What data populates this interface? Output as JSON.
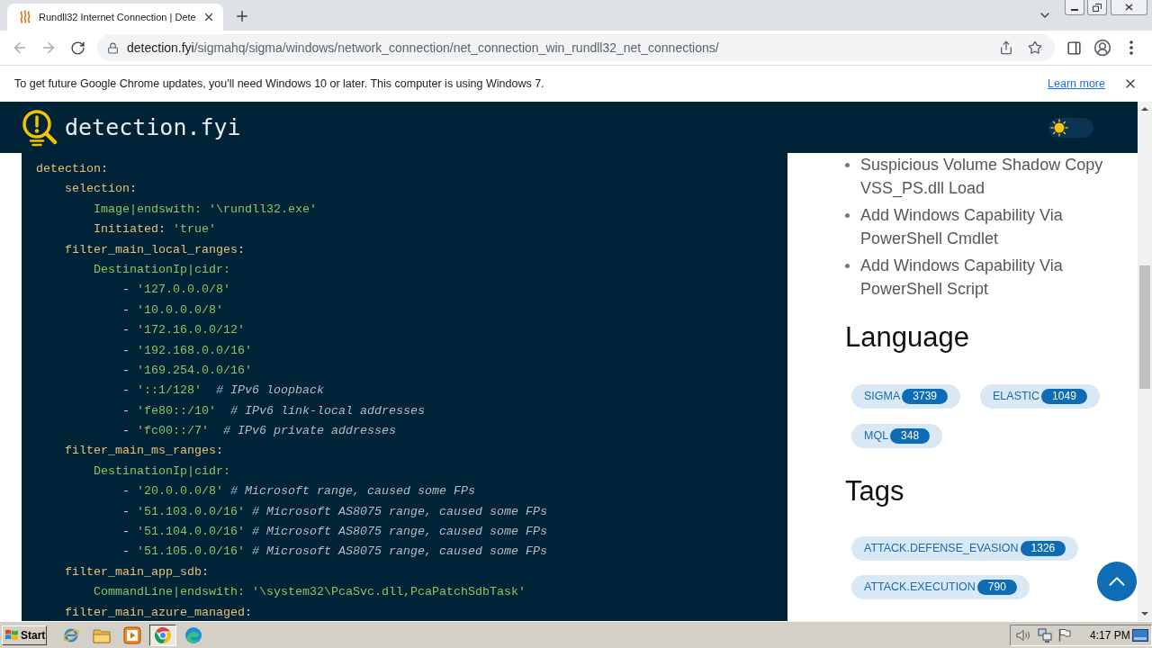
{
  "browser": {
    "tabs": [
      {
        "title": "Rundll32 Internet Connection | Dete",
        "selected": true
      }
    ],
    "address": {
      "host": "detection.fyi",
      "path": "/sigmahq/sigma/windows/network_connection/net_connection_win_rundll32_net_connections/"
    },
    "infobar": {
      "message": "To get future Google Chrome updates, you'll need Windows 10 or later. This computer is using Windows 7.",
      "link": "Learn more"
    }
  },
  "site_header": {
    "logo_text": "detection.fyi",
    "theme_toggle": {
      "on": false
    }
  },
  "code": [
    {
      "parts": [
        {
          "kind": "key",
          "text": "detection"
        },
        {
          "kind": "punct",
          "text": ":"
        }
      ],
      "children": [
        {
          "parts": [
            {
              "kind": "key",
              "text": "selection"
            },
            {
              "kind": "punct",
              "text": ":"
            }
          ],
          "children": [
            {
              "parts": [
                {
                  "kind": "field",
                  "text": "Image|endswith:"
                },
                {
                  "kind": "string",
                  "text": " '\\rundll32.exe'"
                }
              ]
            },
            {
              "parts": [
                {
                  "kind": "key",
                  "text": "Initiated"
                },
                {
                  "kind": "punct",
                  "text": ": "
                },
                {
                  "kind": "string",
                  "text": "'true'"
                }
              ]
            }
          ]
        },
        {
          "parts": [
            {
              "kind": "key",
              "text": "filter_main_local_ranges"
            },
            {
              "kind": "punct",
              "text": ":"
            }
          ],
          "children": [
            {
              "parts": [
                {
                  "kind": "field",
                  "text": "DestinationIp|cidr:"
                }
              ],
              "children": [
                {
                  "parts": [
                    {
                      "kind": "punct",
                      "text": "- "
                    },
                    {
                      "kind": "string",
                      "text": "'127.0.0.0/8'"
                    }
                  ]
                },
                {
                  "parts": [
                    {
                      "kind": "punct",
                      "text": "- "
                    },
                    {
                      "kind": "string",
                      "text": "'10.0.0.0/8'"
                    }
                  ]
                },
                {
                  "parts": [
                    {
                      "kind": "punct",
                      "text": "- "
                    },
                    {
                      "kind": "string",
                      "text": "'172.16.0.0/12'"
                    }
                  ]
                },
                {
                  "parts": [
                    {
                      "kind": "punct",
                      "text": "- "
                    },
                    {
                      "kind": "string",
                      "text": "'192.168.0.0/16'"
                    }
                  ]
                },
                {
                  "parts": [
                    {
                      "kind": "punct",
                      "text": "- "
                    },
                    {
                      "kind": "string",
                      "text": "'169.254.0.0/16'"
                    }
                  ]
                },
                {
                  "parts": [
                    {
                      "kind": "punct",
                      "text": "- "
                    },
                    {
                      "kind": "string",
                      "text": "'::1/128'"
                    },
                    {
                      "kind": "comment",
                      "text": "  # IPv6 loopback"
                    }
                  ]
                },
                {
                  "parts": [
                    {
                      "kind": "punct",
                      "text": "- "
                    },
                    {
                      "kind": "string",
                      "text": "'fe80::/10'"
                    },
                    {
                      "kind": "comment",
                      "text": "  # IPv6 link-local addresses"
                    }
                  ]
                },
                {
                  "parts": [
                    {
                      "kind": "punct",
                      "text": "- "
                    },
                    {
                      "kind": "string",
                      "text": "'fc00::/7'"
                    },
                    {
                      "kind": "comment",
                      "text": "  # IPv6 private addresses"
                    }
                  ]
                }
              ]
            }
          ]
        },
        {
          "parts": [
            {
              "kind": "key",
              "text": "filter_main_ms_ranges"
            },
            {
              "kind": "punct",
              "text": ":"
            }
          ],
          "children": [
            {
              "parts": [
                {
                  "kind": "field",
                  "text": "DestinationIp|cidr:"
                }
              ],
              "children": [
                {
                  "parts": [
                    {
                      "kind": "punct",
                      "text": "- "
                    },
                    {
                      "kind": "string",
                      "text": "'20.0.0.0/8'"
                    },
                    {
                      "kind": "comment",
                      "text": " # Microsoft range, caused some FPs"
                    }
                  ]
                },
                {
                  "parts": [
                    {
                      "kind": "punct",
                      "text": "- "
                    },
                    {
                      "kind": "string",
                      "text": "'51.103.0.0/16'"
                    },
                    {
                      "kind": "comment",
                      "text": " # Microsoft AS8075 range, caused some FPs"
                    }
                  ]
                },
                {
                  "parts": [
                    {
                      "kind": "punct",
                      "text": "- "
                    },
                    {
                      "kind": "string",
                      "text": "'51.104.0.0/16'"
                    },
                    {
                      "kind": "comment",
                      "text": " # Microsoft AS8075 range, caused some FPs"
                    }
                  ]
                },
                {
                  "parts": [
                    {
                      "kind": "punct",
                      "text": "- "
                    },
                    {
                      "kind": "string",
                      "text": "'51.105.0.0/16'"
                    },
                    {
                      "kind": "comment",
                      "text": " # Microsoft AS8075 range, caused some FPs"
                    }
                  ]
                }
              ]
            }
          ]
        },
        {
          "parts": [
            {
              "kind": "key",
              "text": "filter_main_app_sdb"
            },
            {
              "kind": "punct",
              "text": ":"
            }
          ],
          "children": [
            {
              "parts": [
                {
                  "kind": "field",
                  "text": "CommandLine|endswith:"
                },
                {
                  "kind": "string",
                  "text": " '\\system32\\PcaSvc.dll,PcaPatchSdbTask'"
                }
              ]
            }
          ]
        },
        {
          "parts": [
            {
              "kind": "key",
              "text": "filter_main_azure_managed"
            },
            {
              "kind": "punct",
              "text": ":"
            }
          ]
        }
      ]
    }
  ],
  "sidebar": {
    "related_rules": [
      "Suspicious Volume Shadow Copy VSS_PS.dll Load",
      "Add Windows Capability Via PowerShell Cmdlet",
      "Add Windows Capability Via PowerShell Script"
    ],
    "language": {
      "title": "Language",
      "tags": [
        {
          "label": "SIGMA",
          "count": "3739"
        },
        {
          "label": "ELASTIC",
          "count": "1049"
        },
        {
          "label": "MQL",
          "count": "348"
        }
      ]
    },
    "tags": {
      "title": "Tags",
      "tags": [
        {
          "label": "ATTACK.DEFENSE_EVASION",
          "count": "1326"
        },
        {
          "label": "ATTACK.EXECUTION",
          "count": "790"
        }
      ]
    }
  },
  "taskbar": {
    "start_label": "Start",
    "apps": [
      {
        "kind": "ie",
        "active": false
      },
      {
        "kind": "folder",
        "active": false
      },
      {
        "kind": "media",
        "active": false
      },
      {
        "kind": "chrome",
        "active": true
      },
      {
        "kind": "edge",
        "active": false
      }
    ],
    "clock": "4:17 PM"
  }
}
